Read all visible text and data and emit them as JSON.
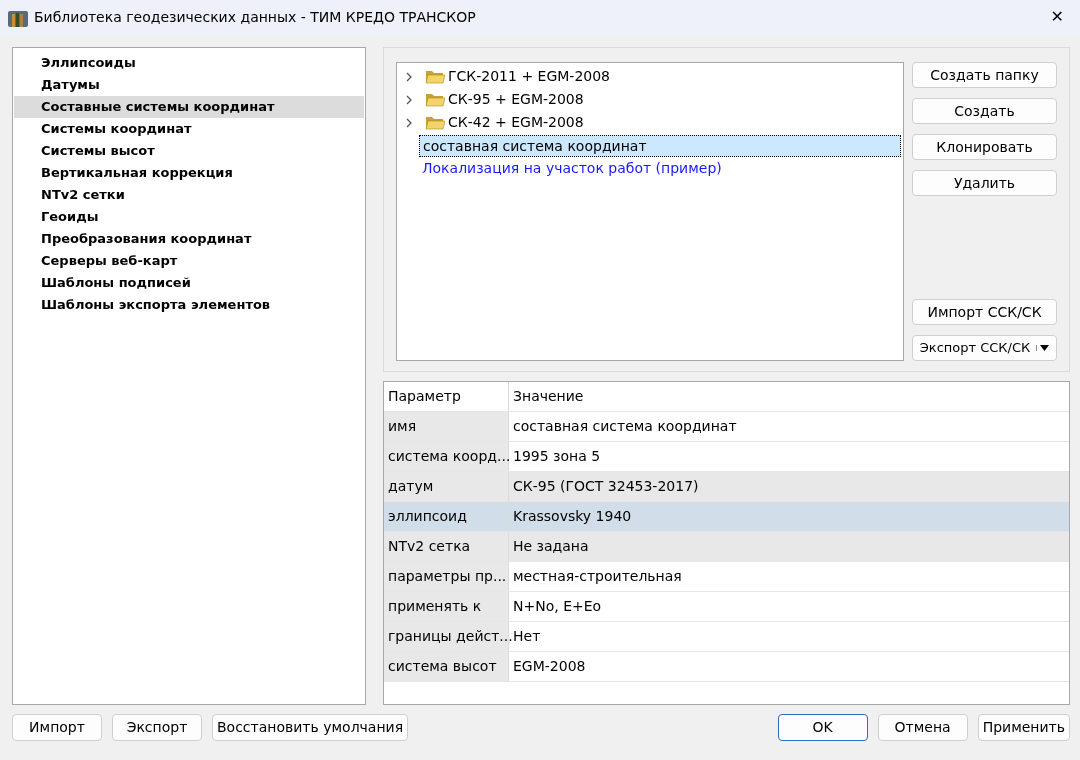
{
  "window": {
    "title": "Библиотека геодезических данных - ТИМ КРЕДО ТРАНСКОР",
    "close": "✕"
  },
  "sidebar": {
    "items": [
      {
        "label": "Эллипсоиды",
        "selected": false
      },
      {
        "label": "Датумы",
        "selected": false
      },
      {
        "label": "Составные системы координат",
        "selected": true
      },
      {
        "label": "Системы координат",
        "selected": false
      },
      {
        "label": "Системы высот",
        "selected": false
      },
      {
        "label": "Вертикальная коррекция",
        "selected": false
      },
      {
        "label": "NTv2 сетки",
        "selected": false
      },
      {
        "label": "Геоиды",
        "selected": false
      },
      {
        "label": "Преобразования координат",
        "selected": false
      },
      {
        "label": "Серверы веб-карт",
        "selected": false
      },
      {
        "label": "Шаблоны подписей",
        "selected": false
      },
      {
        "label": "Шаблоны экспорта элементов",
        "selected": false
      }
    ]
  },
  "tree": {
    "items": [
      {
        "kind": "folder",
        "label": "ГСК-2011 + EGM-2008",
        "expanded": false,
        "selected": false
      },
      {
        "kind": "folder",
        "label": "СК-95 + EGM-2008",
        "expanded": false,
        "selected": false
      },
      {
        "kind": "folder",
        "label": "СК-42 + EGM-2008",
        "expanded": false,
        "selected": false
      },
      {
        "kind": "item",
        "label": "составная система координат",
        "selected": true
      },
      {
        "kind": "link",
        "label": "Локализация на участок работ (пример)",
        "selected": false
      }
    ]
  },
  "actions": {
    "top": [
      {
        "label": "Создать папку"
      },
      {
        "label": "Создать"
      },
      {
        "label": "Клонировать"
      },
      {
        "label": "Удалить"
      }
    ],
    "bottom": [
      {
        "label": "Импорт ССК/СК",
        "dropdown": false
      },
      {
        "label": "Экспорт ССК/СК",
        "dropdown": true
      }
    ]
  },
  "table": {
    "columns": [
      "Параметр",
      "Значение"
    ],
    "rows": [
      {
        "cells": [
          "имя",
          "составная система координат"
        ],
        "shaded": false,
        "selected": false
      },
      {
        "cells": [
          "система коорд...",
          "1995 зона 5"
        ],
        "shaded": false,
        "selected": false
      },
      {
        "cells": [
          "датум",
          "СК-95 (ГОСТ 32453-2017)"
        ],
        "shaded": true,
        "selected": false
      },
      {
        "cells": [
          "эллипсоид",
          "Krassovsky 1940"
        ],
        "shaded": false,
        "selected": true
      },
      {
        "cells": [
          "NTv2 сетка",
          "Не задана"
        ],
        "shaded": true,
        "selected": false
      },
      {
        "cells": [
          "параметры пр...",
          "местная-строительная"
        ],
        "shaded": false,
        "selected": false
      },
      {
        "cells": [
          "применять к",
          "N+No, E+Eo"
        ],
        "shaded": false,
        "selected": false
      },
      {
        "cells": [
          "границы дейст...",
          "Нет"
        ],
        "shaded": false,
        "selected": false
      },
      {
        "cells": [
          "система высот",
          "EGM-2008"
        ],
        "shaded": false,
        "selected": false
      }
    ]
  },
  "footer": {
    "left": [
      {
        "label": "Импорт",
        "default": false
      },
      {
        "label": "Экспорт",
        "default": false
      },
      {
        "label": "Восстановить умолчания",
        "default": false
      }
    ],
    "right": [
      {
        "label": "OK",
        "default": true
      },
      {
        "label": "Отмена",
        "default": false
      },
      {
        "label": "Применить",
        "default": false
      }
    ]
  }
}
